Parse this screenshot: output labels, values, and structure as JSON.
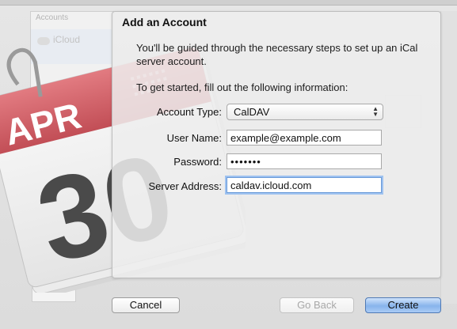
{
  "background": {
    "sidebar_header": "Accounts",
    "sidebar_item": "iCloud"
  },
  "calendar_icon": {
    "month": "APR",
    "day": "30"
  },
  "dialog": {
    "title": "Add an Account",
    "intro": "You'll be guided through the necessary steps to set up an iCal server account.",
    "instruction": "To get started, fill out the following information:",
    "fields": {
      "account_type": {
        "label": "Account Type:",
        "value": "CalDAV"
      },
      "user_name": {
        "label": "User Name:",
        "value": "example@example.com"
      },
      "password": {
        "label": "Password:",
        "value": "•••••••"
      },
      "server_address": {
        "label": "Server Address:",
        "value": "caldav.icloud.com"
      }
    }
  },
  "buttons": {
    "cancel": "Cancel",
    "go_back": "Go Back",
    "create": "Create"
  },
  "colors": {
    "accent": "#88b4ec",
    "focus_ring": "#9ec2f0",
    "calendar_red": "#d9636a"
  }
}
